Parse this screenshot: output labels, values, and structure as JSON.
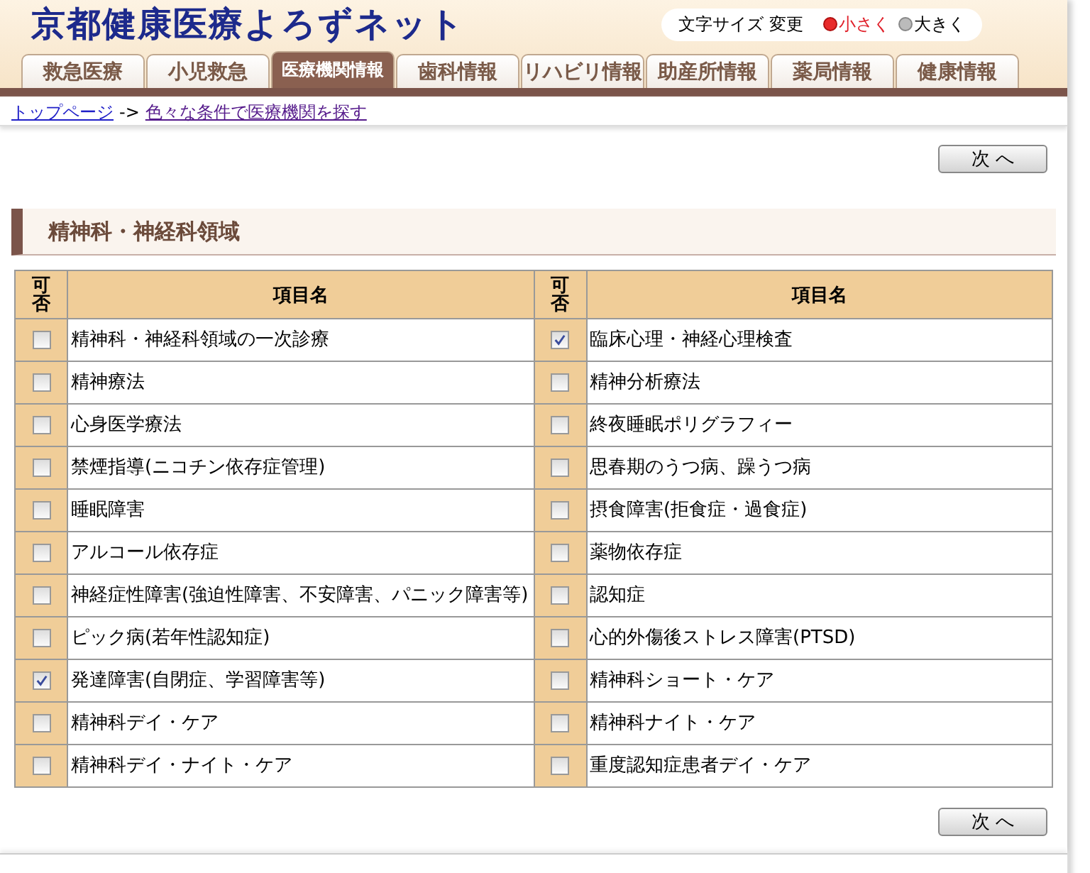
{
  "site_title": "京都健康医療よろずネット",
  "font_size": {
    "label": "文字サイズ 変更",
    "options": [
      {
        "label": "小さく",
        "selected": true
      },
      {
        "label": "大きく",
        "selected": false
      }
    ]
  },
  "tabs": [
    {
      "label": "救急医療",
      "selected": false
    },
    {
      "label": "小児救急",
      "selected": false
    },
    {
      "label": "医療機関情報",
      "selected": true
    },
    {
      "label": "歯科情報",
      "selected": false
    },
    {
      "label": "リハビリ情報",
      "selected": false
    },
    {
      "label": "助産所情報",
      "selected": false
    },
    {
      "label": "薬局情報",
      "selected": false
    },
    {
      "label": "健康情報",
      "selected": false
    }
  ],
  "breadcrumb": {
    "items": [
      "トップページ",
      "色々な条件で医療機関を探す"
    ],
    "separator": "->"
  },
  "next_button_top": "次 へ",
  "section_title": "精神科・神経科領域",
  "table": {
    "columns": [
      "可否",
      "項目名",
      "可否",
      "項目名"
    ],
    "rows": [
      [
        {
          "kind": "checkbox",
          "checked": false
        },
        {
          "kind": "text",
          "text": "精神科・神経科領域の一次診療"
        },
        {
          "kind": "checkbox",
          "checked": true
        },
        {
          "kind": "text",
          "text": "臨床心理・神経心理検査"
        }
      ],
      [
        {
          "kind": "checkbox",
          "checked": false
        },
        {
          "kind": "text",
          "text": "精神療法"
        },
        {
          "kind": "checkbox",
          "checked": false
        },
        {
          "kind": "text",
          "text": "精神分析療法"
        }
      ],
      [
        {
          "kind": "checkbox",
          "checked": false
        },
        {
          "kind": "text",
          "text": "心身医学療法"
        },
        {
          "kind": "checkbox",
          "checked": false
        },
        {
          "kind": "text",
          "text": "終夜睡眠ポリグラフィー"
        }
      ],
      [
        {
          "kind": "checkbox",
          "checked": false
        },
        {
          "kind": "text",
          "text": "禁煙指導(ニコチン依存症管理)"
        },
        {
          "kind": "checkbox",
          "checked": false
        },
        {
          "kind": "text",
          "text": "思春期のうつ病、躁うつ病"
        }
      ],
      [
        {
          "kind": "checkbox",
          "checked": false
        },
        {
          "kind": "text",
          "text": "睡眠障害"
        },
        {
          "kind": "checkbox",
          "checked": false
        },
        {
          "kind": "text",
          "text": "摂食障害(拒食症・過食症)"
        }
      ],
      [
        {
          "kind": "checkbox",
          "checked": false
        },
        {
          "kind": "text",
          "text": "アルコール依存症"
        },
        {
          "kind": "checkbox",
          "checked": false
        },
        {
          "kind": "text",
          "text": "薬物依存症"
        }
      ],
      [
        {
          "kind": "checkbox",
          "checked": false
        },
        {
          "kind": "text",
          "text": "神経症性障害(強迫性障害、不安障害、パニック障害等)"
        },
        {
          "kind": "checkbox",
          "checked": false
        },
        {
          "kind": "text",
          "text": "認知症"
        }
      ],
      [
        {
          "kind": "checkbox",
          "checked": false
        },
        {
          "kind": "text",
          "text": "ピック病(若年性認知症)"
        },
        {
          "kind": "checkbox",
          "checked": false
        },
        {
          "kind": "text",
          "text": "心的外傷後ストレス障害(PTSD)"
        }
      ],
      [
        {
          "kind": "checkbox",
          "checked": true
        },
        {
          "kind": "text",
          "text": "発達障害(自閉症、学習障害等)"
        },
        {
          "kind": "checkbox",
          "checked": false
        },
        {
          "kind": "text",
          "text": "精神科ショート・ケア"
        }
      ],
      [
        {
          "kind": "checkbox",
          "checked": false
        },
        {
          "kind": "text",
          "text": "精神科デイ・ケア"
        },
        {
          "kind": "checkbox",
          "checked": false
        },
        {
          "kind": "text",
          "text": "精神科ナイト・ケア"
        }
      ],
      [
        {
          "kind": "checkbox",
          "checked": false
        },
        {
          "kind": "text",
          "text": "精神科デイ・ナイト・ケア"
        },
        {
          "kind": "checkbox",
          "checked": false
        },
        {
          "kind": "text",
          "text": "重度認知症患者デイ・ケア"
        }
      ]
    ]
  },
  "next_button_bottom": "次 へ"
}
